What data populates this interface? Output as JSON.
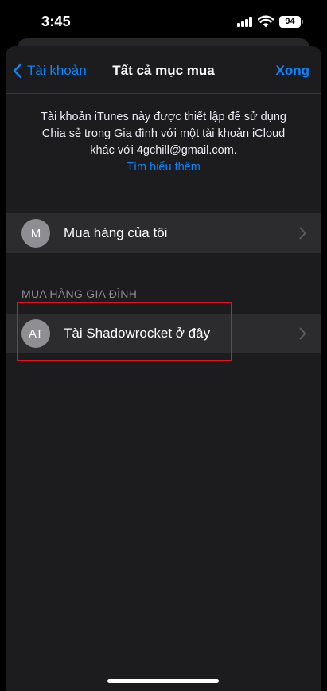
{
  "status_bar": {
    "time": "3:45",
    "battery_level": "94"
  },
  "nav": {
    "back_label": "Tài khoản",
    "title": "Tất cả mục mua",
    "done_label": "Xong"
  },
  "info": {
    "text": "Tài khoản iTunes này được thiết lập để sử dụng Chia sẻ trong Gia đình với một tài khoản iCloud khác với 4gchill@gmail.com.",
    "link": "Tìm hiểu thêm"
  },
  "my_purchases": {
    "avatar": "M",
    "label": "Mua hàng của tôi"
  },
  "family_section": {
    "header": "MUA HÀNG GIA ĐÌNH",
    "items": [
      {
        "avatar": "AT",
        "label": "Tài Shadowrocket ở đây"
      }
    ]
  },
  "colors": {
    "accent": "#0a84ff",
    "highlight": "#e0131f",
    "row_background": "#2c2c2e",
    "sheet_background": "#1c1c1e"
  }
}
